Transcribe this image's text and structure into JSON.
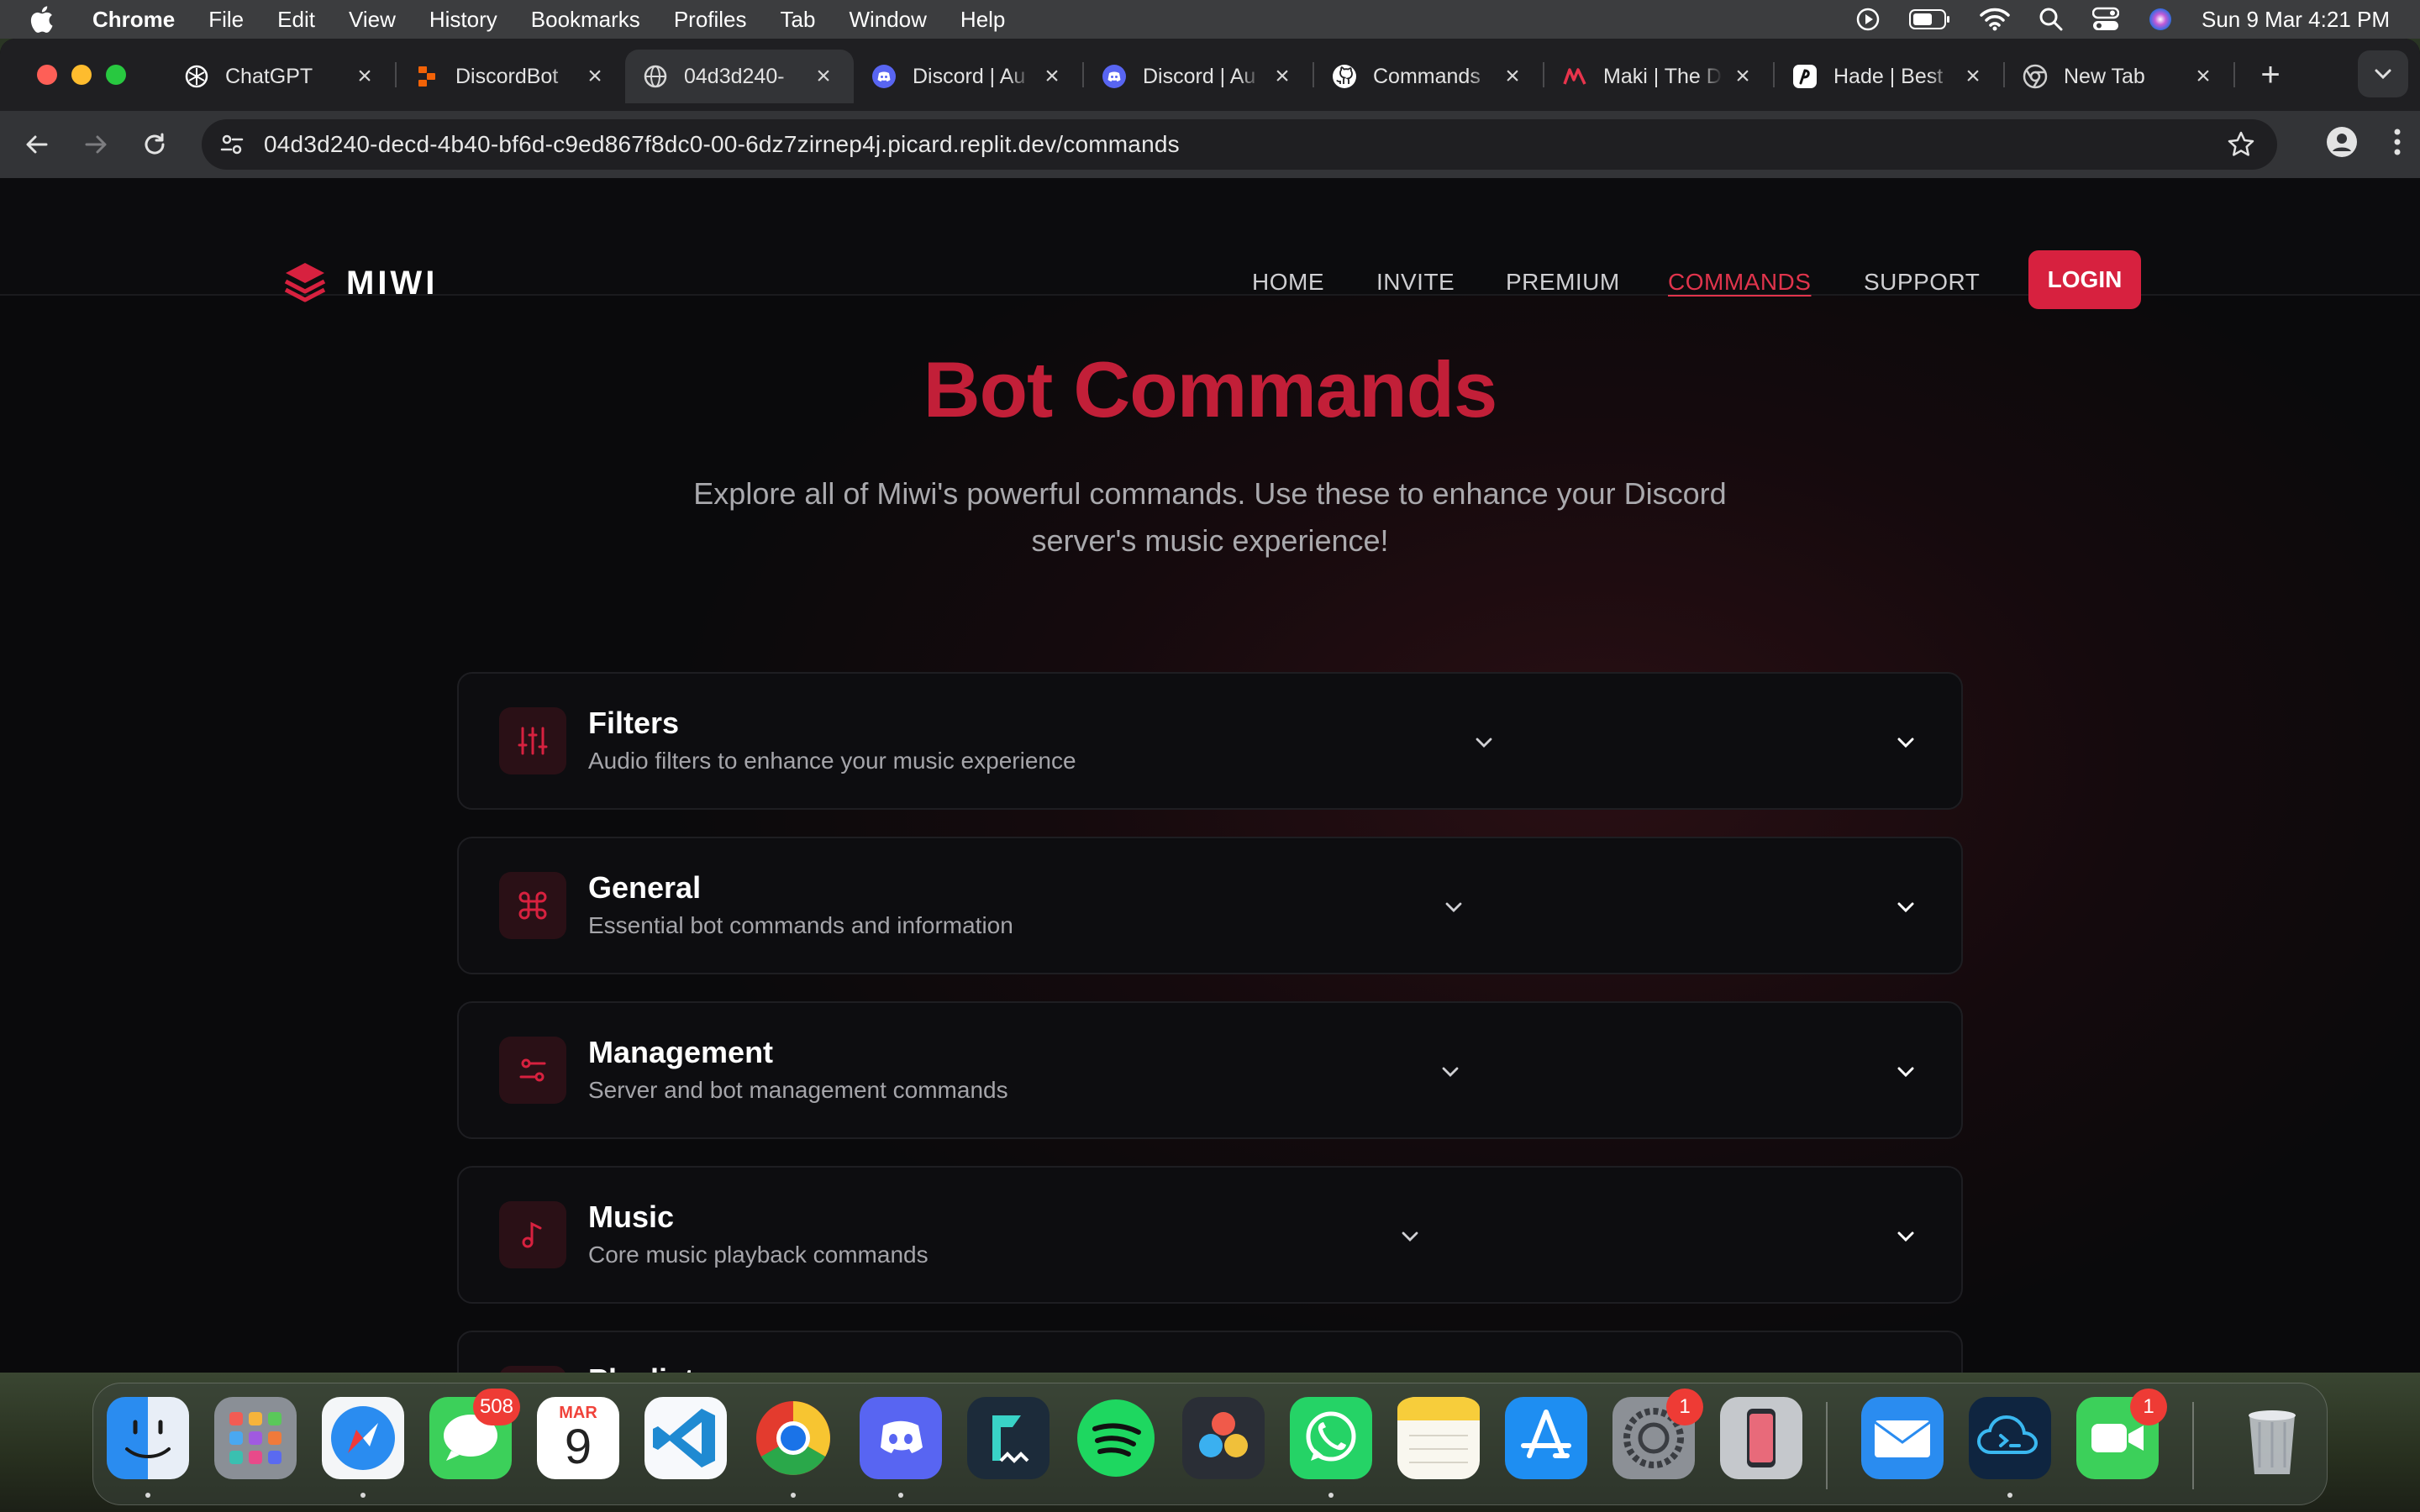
{
  "menubar": {
    "app_name": "Chrome",
    "items": [
      "File",
      "Edit",
      "View",
      "History",
      "Bookmarks",
      "Profiles",
      "Tab",
      "Window",
      "Help"
    ],
    "clock": "Sun 9 Mar  4:21 PM"
  },
  "tabs": [
    {
      "title": "ChatGPT",
      "icon": "openai-icon"
    },
    {
      "title": "DiscordBot",
      "icon": "replit-icon"
    },
    {
      "title": "04d3d240-",
      "icon": "globe-icon",
      "active": true
    },
    {
      "title": "Discord | Au",
      "icon": "discord-icon"
    },
    {
      "title": "Discord | Au",
      "icon": "discord-icon"
    },
    {
      "title": "Commands",
      "icon": "github-icon"
    },
    {
      "title": "Maki | The D",
      "icon": "maki-icon"
    },
    {
      "title": "Hade | Best",
      "icon": "hade-icon"
    },
    {
      "title": "New Tab",
      "icon": "chrome-icon"
    }
  ],
  "toolbar": {
    "url": "04d3d240-decd-4b40-bf6d-c9ed867f8dc0-00-6dz7zirnep4j.picard.replit.dev/commands"
  },
  "site": {
    "brand": "MIWI",
    "nav": [
      "HOME",
      "INVITE",
      "PREMIUM",
      "COMMANDS",
      "SUPPORT"
    ],
    "active_nav": "COMMANDS",
    "login_label": "LOGIN",
    "accent": "#d7213f"
  },
  "hero": {
    "title": "Bot Commands",
    "subtitle": "Explore all of Miwi's powerful commands. Use these to enhance your Discord server's music experience!"
  },
  "categories": [
    {
      "name": "Filters",
      "description": "Audio filters to enhance your music experience",
      "icon": "sliders-icon"
    },
    {
      "name": "General",
      "description": "Essential bot commands and information",
      "icon": "command-icon"
    },
    {
      "name": "Management",
      "description": "Server and bot management commands",
      "icon": "settings-toggle-icon"
    },
    {
      "name": "Music",
      "description": "Core music playback commands",
      "icon": "music-note-icon"
    },
    {
      "name": "Playlist",
      "description": "",
      "icon": "playlist-icon"
    }
  ],
  "dock": {
    "messages_badge": "508",
    "calendar_month": "MAR",
    "calendar_day": "9",
    "settings_badge": "1",
    "facetime_badge": "1"
  }
}
